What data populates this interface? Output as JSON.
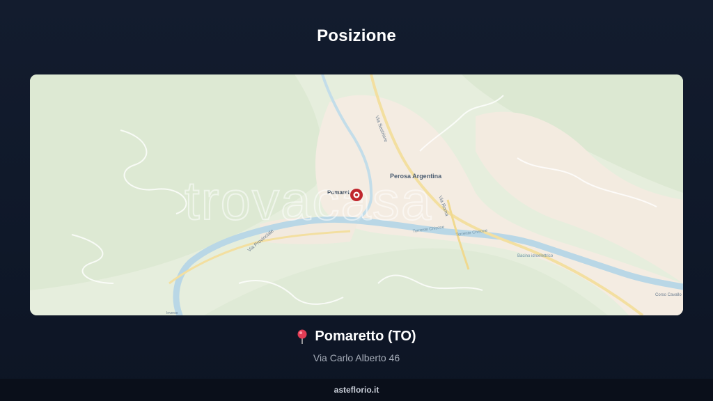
{
  "header": {
    "title": "Posizione"
  },
  "map": {
    "labels": {
      "town_main": "Perosa Argentina",
      "marker_town": "Pomaret",
      "road_1": "Via Sestriere",
      "road_2": "Via Provinciale",
      "road_3": "Via Roma",
      "river_1": "Torrente Chisone",
      "river_2": "Torrente Chisone",
      "basin": "Bacino idroelettrico",
      "corner": "Corso Cavallo",
      "bottom": "Inverso"
    },
    "watermark": "trovacasa",
    "colors": {
      "land": "#e7efdf",
      "urban": "#f5ede4",
      "water": "#b7d6e4",
      "road": "#f6e3a6",
      "marker": "#c0262d"
    }
  },
  "location": {
    "pin_icon": "pin-icon",
    "name": "Pomaretto (TO)",
    "address": "Via Carlo Alberto 46"
  },
  "footer": {
    "site": "asteflorio.it"
  }
}
